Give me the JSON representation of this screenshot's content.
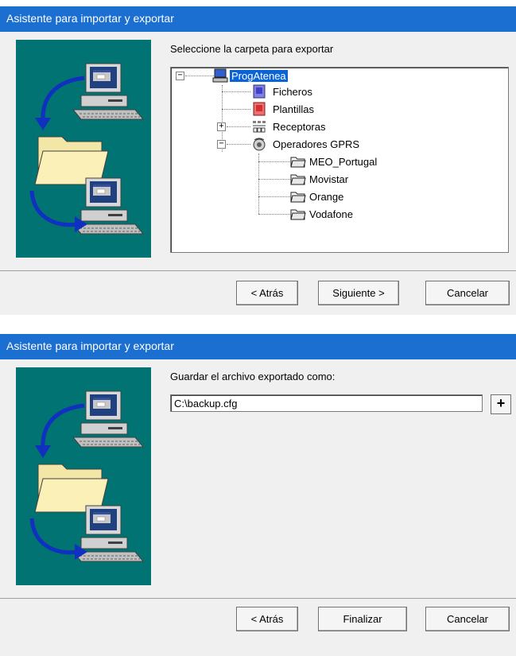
{
  "colors": {
    "title_bar": "#1b6fd0",
    "art_bg": "#007372",
    "selection": "#0a64d8",
    "dialog_bg": "#f0f0f0"
  },
  "dialog1": {
    "title": "Asistente para importar y exportar",
    "prompt": "Seleccione la carpeta para exportar",
    "tree": {
      "root": {
        "label": "ProgAtenea",
        "icon": "computer-icon",
        "selected": true,
        "expanded": true
      },
      "items": [
        {
          "label": "Ficheros",
          "icon": "files-icon"
        },
        {
          "label": "Plantillas",
          "icon": "templates-icon"
        },
        {
          "label": "Receptoras",
          "icon": "receivers-icon",
          "expanded": false
        },
        {
          "label": "Operadores GPRS",
          "icon": "gprs-operator-icon",
          "expanded": true,
          "children": [
            {
              "label": "MEO_Portugal",
              "icon": "folder-icon"
            },
            {
              "label": "Movistar",
              "icon": "folder-icon"
            },
            {
              "label": "Orange",
              "icon": "folder-icon"
            },
            {
              "label": "Vodafone",
              "icon": "folder-icon"
            }
          ]
        }
      ]
    },
    "buttons": {
      "back": "< Atrás",
      "next": "Siguiente >",
      "cancel": "Cancelar"
    }
  },
  "dialog2": {
    "title": "Asistente para importar y exportar",
    "prompt": "Guardar el archivo exportado como:",
    "file_value": "C:\\backup.cfg",
    "browse_label": "+",
    "buttons": {
      "back": "< Atrás",
      "finish": "Finalizar",
      "cancel": "Cancelar"
    }
  }
}
